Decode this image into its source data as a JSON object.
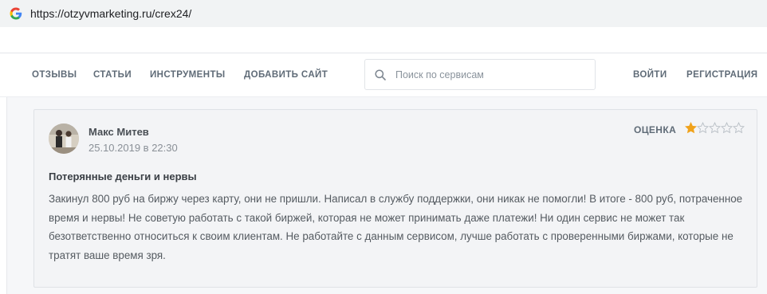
{
  "browser": {
    "icon": "google-g-icon",
    "url": "https://otzyvmarketing.ru/crex24/"
  },
  "nav": {
    "items": [
      "ОТЗЫВЫ",
      "СТАТЬИ",
      "ИНСТРУМЕНТЫ",
      "ДОБАВИТЬ САЙТ"
    ],
    "search_placeholder": "Поиск по сервисам",
    "login": "ВОЙТИ",
    "register": "РЕГИСТРАЦИЯ"
  },
  "review": {
    "author": "Макс Митев",
    "date": "25.10.2019 в 22:30",
    "rating_label": "ОЦЕНКА",
    "rating": 1,
    "rating_max": 5,
    "title": "Потерянные деньги и нервы",
    "text": "Закинул 800 руб на биржу через карту, они не пришли. Написал в службу поддержки, они никак не помогли! В итоге - 800 руб, потраченное время и нервы! Не советую работать с такой биржей, которая не может принимать даже платежи! Ни один сервис не может так безответственно относиться к своим клиентам. Не работайте с данным сервисом, лучше работать с проверенными биржами, которые не тратят ваше время зря."
  },
  "colors": {
    "star_filled": "#f0a21b",
    "star_empty": "#b8bec5",
    "nav_text": "#5f6b77"
  }
}
